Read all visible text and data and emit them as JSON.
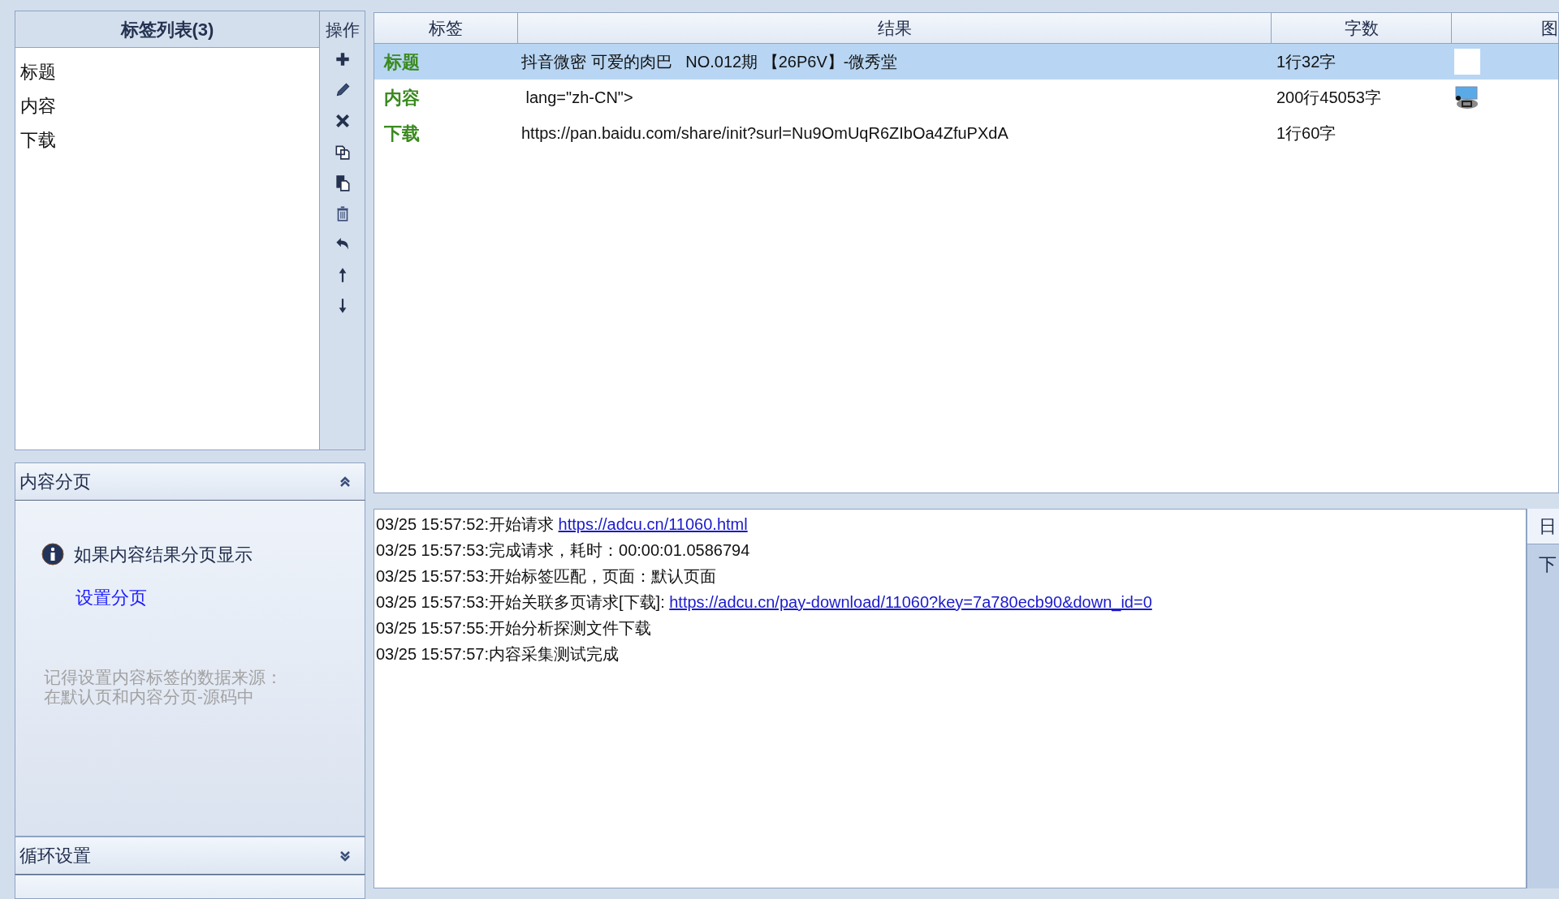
{
  "tag_list": {
    "title": "标签列表(3)",
    "items": [
      "标题",
      "内容",
      "下载"
    ]
  },
  "toolbar": {
    "title": "操作"
  },
  "pagination_panel": {
    "title": "内容分页",
    "expanded": true,
    "info": "如果内容结果分页显示",
    "link": "设置分页",
    "note": "记得设置内容标签的数据来源：在默认页和内容分页-源码中"
  },
  "loop_panel": {
    "title": "循环设置",
    "expanded": false
  },
  "results": {
    "columns": [
      "标签",
      "结果",
      "字数",
      "图"
    ],
    "rows": [
      {
        "tag": "标题",
        "result_lines": [
          "抖音微密 可爱的肉巴   NO.012期 【26P6V】-微秀堂"
        ],
        "count": "1行32字",
        "kind": "blank",
        "selected": true
      },
      {
        "tag": "内容",
        "result_lines": [
          " lang=\"zh-CN\">"
        ],
        "count": "200行45053字",
        "kind": "picture",
        "selected": false
      },
      {
        "tag": "下载",
        "result_lines": [
          "https://pan.baidu.com/share/init?surl=Nu9OmUqR6ZIbOa4ZfuPXdA"
        ],
        "count": "1行60字",
        "kind": "none",
        "selected": false
      }
    ]
  },
  "log": {
    "lines": [
      {
        "text": "03/25 15:57:52:开始请求 ",
        "link": "https://adcu.cn/11060.html"
      },
      {
        "text": "03/25 15:57:53:完成请求，耗时：00:00:01.0586794"
      },
      {
        "text": "03/25 15:57:53:开始标签匹配，页面：默认页面"
      },
      {
        "text": "03/25 15:57:53:开始关联多页请求[下载]: ",
        "link": "https://adcu.cn/pay-download/11060?key=7a780ecb90&down_id=0"
      },
      {
        "text": "03/25 15:57:55:开始分析探测文件下载"
      },
      {
        "text": "03/25 15:57:57:内容采集测试完成"
      }
    ]
  },
  "side_panel": {
    "tabs": [
      {
        "label": "日",
        "selected": true
      }
    ],
    "items": [
      "下"
    ]
  }
}
